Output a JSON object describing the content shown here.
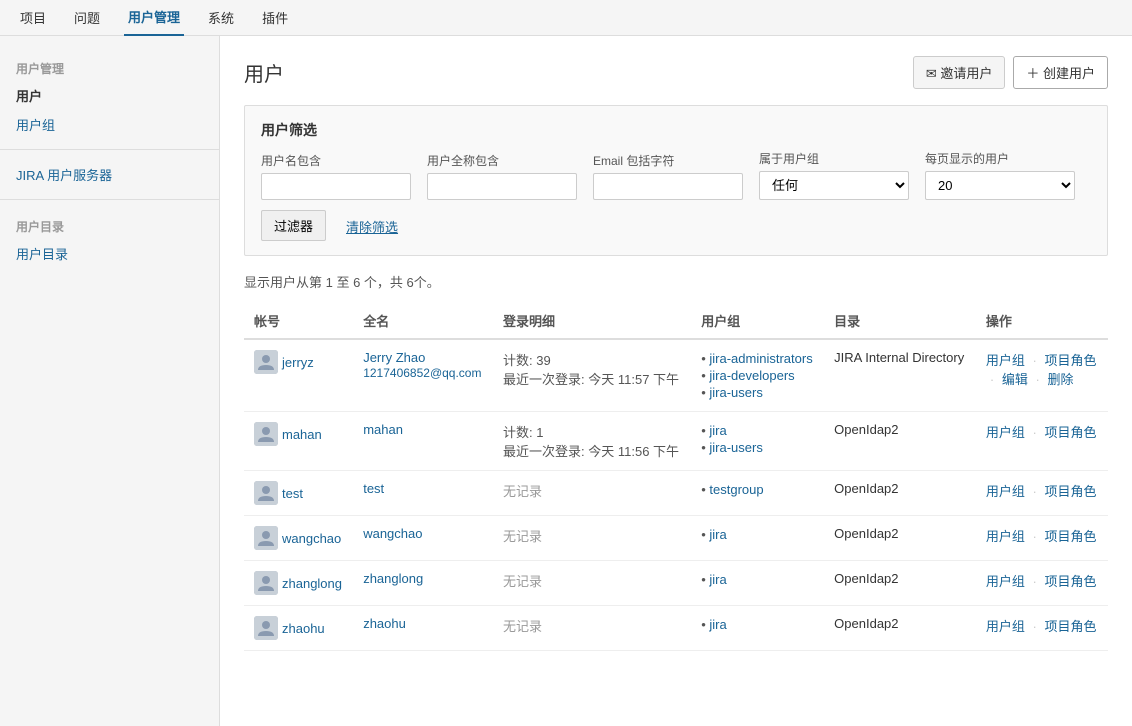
{
  "topnav": {
    "items": [
      {
        "label": "项目",
        "active": false
      },
      {
        "label": "问题",
        "active": false
      },
      {
        "label": "用户管理",
        "active": true
      },
      {
        "label": "系统",
        "active": false
      },
      {
        "label": "插件",
        "active": false
      }
    ]
  },
  "sidebar": {
    "section1": {
      "title": "用户管理",
      "links": [
        {
          "label": "用户",
          "active": true
        },
        {
          "label": "用户组",
          "active": false
        }
      ]
    },
    "section2": {
      "links": [
        {
          "label": "JIRA 用户服务器",
          "active": false
        }
      ]
    },
    "section3": {
      "title": "用户目录",
      "links": [
        {
          "label": "用户目录",
          "active": false
        }
      ]
    }
  },
  "page": {
    "title": "用户",
    "invite_button": "邀请用户",
    "create_button": "＋ 创建用户"
  },
  "filter": {
    "title": "用户筛选",
    "username_label": "用户名包含",
    "fullname_label": "用户全称包含",
    "email_label": "Email 包括字符",
    "group_label": "属于用户组",
    "perpage_label": "每页显示的用户",
    "group_default": "任何",
    "perpage_default": "20",
    "filter_button": "过滤器",
    "clear_button": "清除筛选",
    "username_placeholder": "",
    "fullname_placeholder": "",
    "email_placeholder": ""
  },
  "results": {
    "info": "显示用户从第 1 至 6 个，共 6个。"
  },
  "table": {
    "headers": [
      "帐号",
      "全名",
      "登录明细",
      "用户组",
      "目录",
      "操作"
    ],
    "rows": [
      {
        "account": "jerryz",
        "fullname": "Jerry Zhao",
        "email": "1217406852@qq.com",
        "login_count": "计数: 39",
        "login_last": "最近一次登录: 今天 11:57 下午",
        "groups": [
          "jira-administrators",
          "jira-developers",
          "jira-users"
        ],
        "directory": "JIRA Internal Directory",
        "actions": [
          "用户组",
          "项目角色",
          "编辑",
          "删除"
        ]
      },
      {
        "account": "mahan",
        "fullname": "mahan",
        "email": "",
        "login_count": "计数: 1",
        "login_last": "最近一次登录: 今天 11:56 下午",
        "groups": [
          "jira",
          "jira-users"
        ],
        "directory": "OpenIdap2",
        "actions": [
          "用户组",
          "项目角色"
        ]
      },
      {
        "account": "test",
        "fullname": "test",
        "email": "",
        "login_count": "",
        "login_last": "",
        "no_record": "无记录",
        "groups": [
          "testgroup"
        ],
        "directory": "OpenIdap2",
        "actions": [
          "用户组",
          "项目角色"
        ]
      },
      {
        "account": "wangchao",
        "fullname": "wangchao",
        "email": "",
        "login_count": "",
        "login_last": "",
        "no_record": "无记录",
        "groups": [
          "jira"
        ],
        "directory": "OpenIdap2",
        "actions": [
          "用户组",
          "项目角色"
        ]
      },
      {
        "account": "zhanglong",
        "fullname": "zhanglong",
        "email": "",
        "login_count": "",
        "login_last": "",
        "no_record": "无记录",
        "groups": [
          "jira"
        ],
        "directory": "OpenIdap2",
        "actions": [
          "用户组",
          "项目角色"
        ]
      },
      {
        "account": "zhaohu",
        "fullname": "zhaohu",
        "email": "",
        "login_count": "",
        "login_last": "",
        "no_record": "无记录",
        "groups": [
          "jira"
        ],
        "directory": "OpenIdap2",
        "actions": [
          "用户组",
          "项目角色"
        ]
      }
    ]
  }
}
